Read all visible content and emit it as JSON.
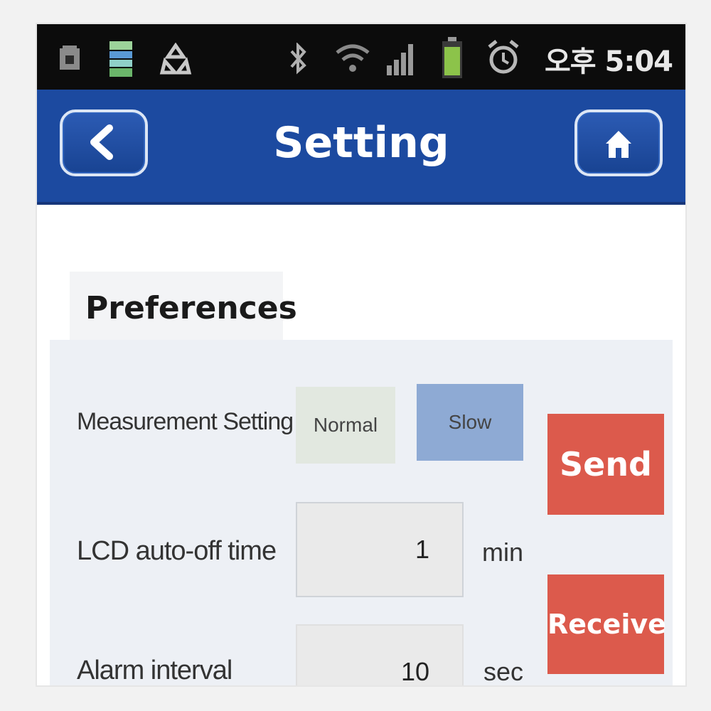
{
  "status_bar": {
    "time": "오후 5:04",
    "icons": [
      "sd-card-icon",
      "data-sync-icon",
      "recycle-icon",
      "bluetooth-icon",
      "wifi-icon",
      "signal-icon",
      "battery-icon",
      "alarm-icon"
    ]
  },
  "app_bar": {
    "title": "Setting",
    "back_icon": "chevron-left-icon",
    "home_icon": "home-icon"
  },
  "tab": {
    "label": "Preferences"
  },
  "form": {
    "measurement": {
      "label": "Measurement Setting",
      "options": [
        "Normal",
        "Slow"
      ],
      "selected": "Slow"
    },
    "lcd": {
      "label": "LCD auto-off time",
      "value": "1",
      "unit": "min"
    },
    "alarm": {
      "label": "Alarm interval",
      "value": "10",
      "unit": "sec"
    }
  },
  "actions": {
    "send": "Send",
    "receive": "Receive"
  },
  "colors": {
    "app_bar": "#1c4aa0",
    "status_bar": "#0c0c0c",
    "action": "#dc5a4c",
    "selected_option": "#8eaad4",
    "panel": "#edf0f5"
  }
}
